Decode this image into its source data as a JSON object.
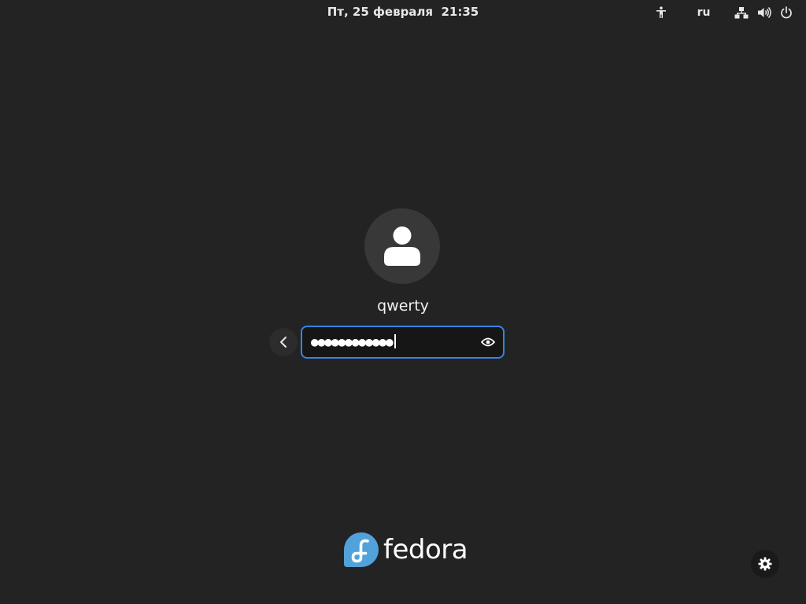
{
  "topbar": {
    "clock": "Пт, 25 февраля  21:35",
    "language": "ru",
    "icons": {
      "accessibility": "accessibility-icon",
      "network": "network-wired-icon",
      "volume": "volume-high-icon",
      "power": "power-icon"
    }
  },
  "login": {
    "avatar_icon": "user-avatar-icon",
    "username": "qwerty",
    "password_masked": "●●●●●●●●●●●●",
    "back_icon": "chevron-left-icon",
    "reveal_icon": "eye-icon"
  },
  "branding": {
    "wordmark": "fedora",
    "logo_icon": "fedora-logo-icon"
  },
  "session_settings_icon": "gear-icon",
  "colors": {
    "background": "#232323",
    "accent": "#3584e4",
    "fedora_blue": "#51a2da"
  }
}
